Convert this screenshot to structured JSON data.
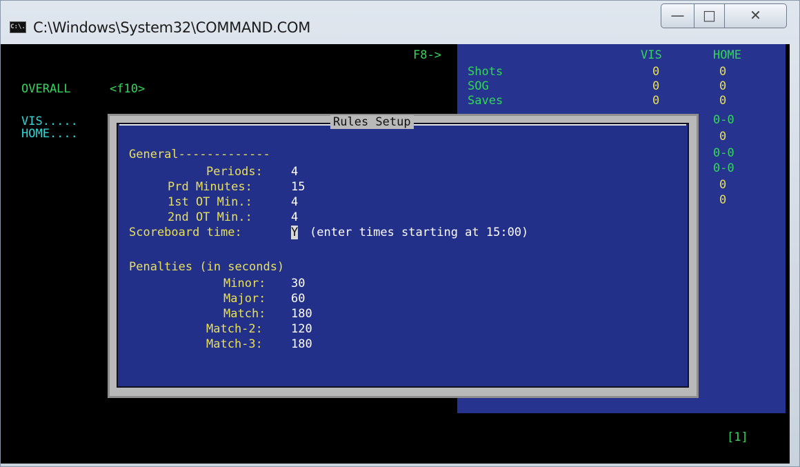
{
  "window": {
    "title": "C:\\Windows\\System32\\COMMAND.COM",
    "icon_text": "C:\\.",
    "controls": {
      "minimize": "—",
      "maximize": "□",
      "close": "✕"
    }
  },
  "console": {
    "f8_label": "F8->",
    "overall_label": "OVERALL",
    "f10_label": "<f10>",
    "vis_label": "VIS.....",
    "home_label": "HOME....",
    "page_indicator": "[1]"
  },
  "stats": {
    "headers": {
      "vis": "VIS",
      "home": "HOME"
    },
    "rows": [
      {
        "label": "Shots",
        "vis": "0",
        "home": "0"
      },
      {
        "label": "SOG",
        "vis": "0",
        "home": "0"
      },
      {
        "label": "Saves",
        "vis": "0",
        "home": "0"
      }
    ],
    "home_extra": [
      "0-0",
      "0",
      "0-0",
      "0-0",
      "0",
      "0"
    ]
  },
  "dialog": {
    "title": "Rules Setup",
    "general_header": "General-------------",
    "fields": [
      {
        "label": "Periods:",
        "value": "4"
      },
      {
        "label": "Prd Minutes:",
        "value": "15"
      },
      {
        "label": "1st OT Min.:",
        "value": "4"
      },
      {
        "label": "2nd OT Min.:",
        "value": "4"
      }
    ],
    "scoreboard_label": "Scoreboard time:",
    "scoreboard_value": "Y",
    "scoreboard_hint": "(enter times starting at 15:00)",
    "penalties_header": "Penalties (in seconds)",
    "penalties": [
      {
        "label": "Minor:",
        "value": "30"
      },
      {
        "label": "Major:",
        "value": "60"
      },
      {
        "label": "Match:",
        "value": "180"
      },
      {
        "label": "Match-2:",
        "value": "120"
      },
      {
        "label": "Match-3:",
        "value": "180"
      }
    ]
  }
}
